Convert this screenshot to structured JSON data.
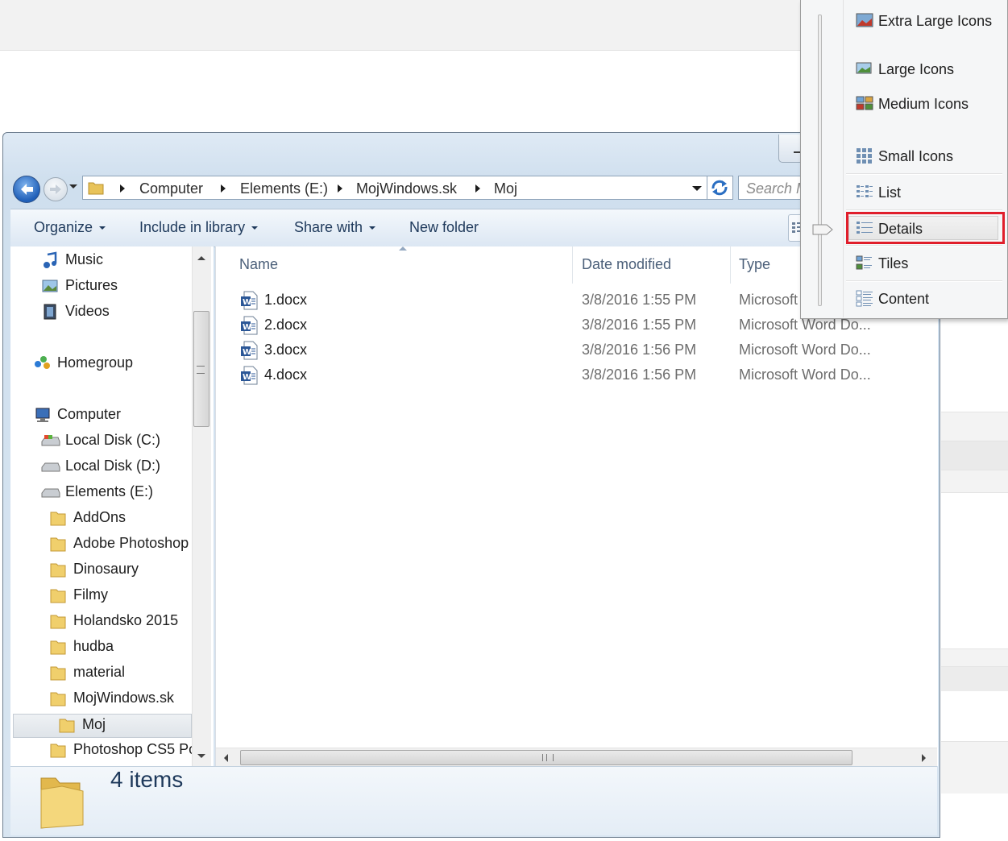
{
  "window": {
    "address_path": [
      "Computer",
      "Elements (E:)",
      "MojWindows.sk",
      "Moj"
    ],
    "search_placeholder": "Search M"
  },
  "toolbar": {
    "organize": "Organize",
    "include_in_library": "Include in library",
    "share_with": "Share with",
    "new_folder": "New folder"
  },
  "nav": {
    "items": [
      {
        "label": "Music",
        "icon": "music-icon"
      },
      {
        "label": "Pictures",
        "icon": "pictures-icon"
      },
      {
        "label": "Videos",
        "icon": "videos-icon"
      },
      {
        "label": "Homegroup",
        "icon": "homegroup-icon"
      },
      {
        "label": "Computer",
        "icon": "computer-icon"
      },
      {
        "label": "Local Disk (C:)",
        "icon": "drive-icon"
      },
      {
        "label": "Local Disk (D:)",
        "icon": "drive-icon"
      },
      {
        "label": "Elements (E:)",
        "icon": "drive-icon"
      },
      {
        "label": "AddOns",
        "icon": "folder-icon"
      },
      {
        "label": "Adobe Photoshop",
        "icon": "folder-icon"
      },
      {
        "label": "Dinosaury",
        "icon": "folder-icon"
      },
      {
        "label": "Filmy",
        "icon": "folder-icon"
      },
      {
        "label": "Holandsko 2015",
        "icon": "folder-icon"
      },
      {
        "label": "hudba",
        "icon": "folder-icon"
      },
      {
        "label": "material",
        "icon": "folder-icon"
      },
      {
        "label": "MojWindows.sk",
        "icon": "folder-icon"
      },
      {
        "label": "Moj",
        "icon": "folder-icon"
      },
      {
        "label": "Photoshop CS5 Po",
        "icon": "folder-icon"
      }
    ]
  },
  "columns": {
    "name": "Name",
    "date_modified": "Date modified",
    "type": "Type"
  },
  "files": [
    {
      "name": "1.docx",
      "date": "3/8/2016 1:55 PM",
      "type": "Microsoft"
    },
    {
      "name": "2.docx",
      "date": "3/8/2016 1:55 PM",
      "type": "Microsoft Word Do..."
    },
    {
      "name": "3.docx",
      "date": "3/8/2016 1:56 PM",
      "type": "Microsoft Word Do..."
    },
    {
      "name": "4.docx",
      "date": "3/8/2016 1:56 PM",
      "type": "Microsoft Word Do..."
    }
  ],
  "status": {
    "item_count": "4 items"
  },
  "view_menu": {
    "items": [
      {
        "label": "Extra Large Icons"
      },
      {
        "label": "Large Icons"
      },
      {
        "label": "Medium Icons"
      },
      {
        "label": "Small Icons"
      },
      {
        "label": "List"
      },
      {
        "label": "Details"
      },
      {
        "label": "Tiles"
      },
      {
        "label": "Content"
      }
    ],
    "selected": "Details",
    "highlight_color": "#e01e2b"
  }
}
